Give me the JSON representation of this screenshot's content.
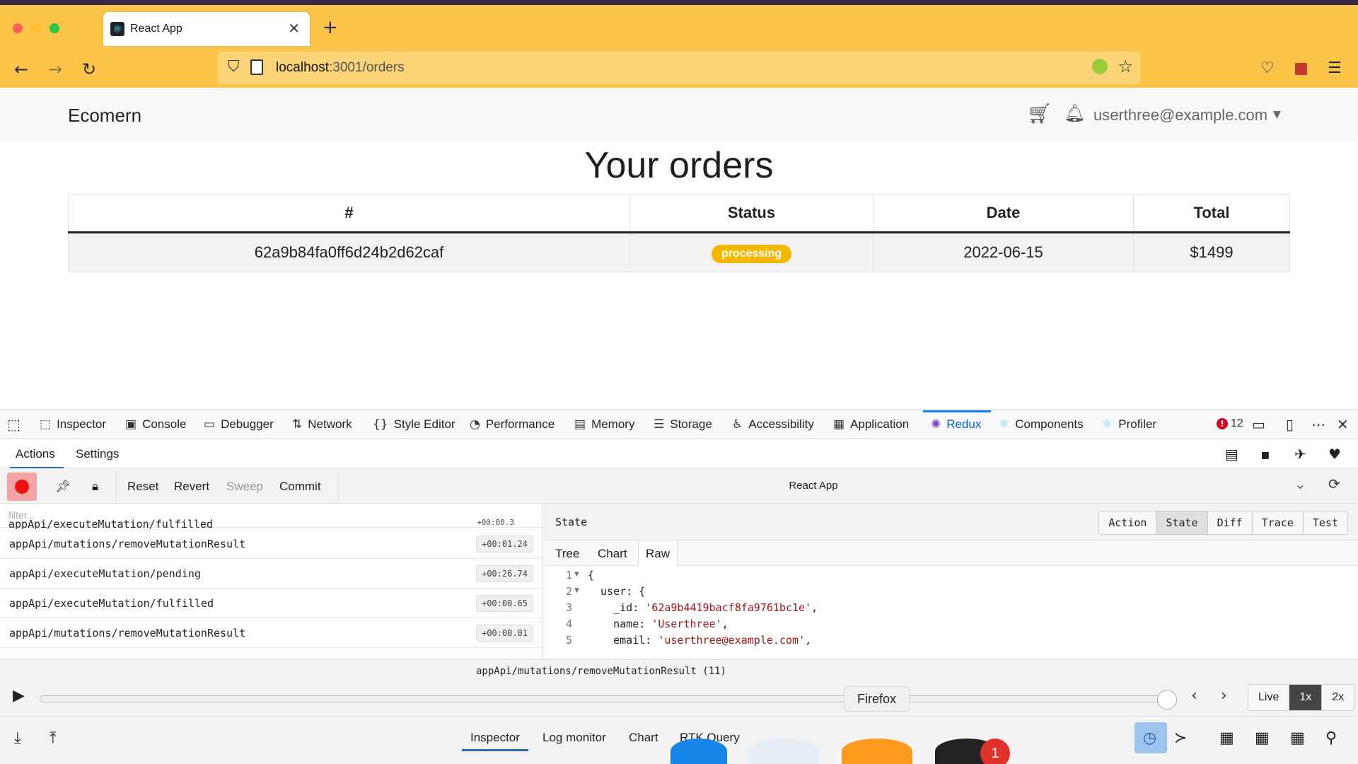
{
  "browser": {
    "tab_title": "React App",
    "tab_close": "✕",
    "new_tab": "+",
    "url_host": "localhost",
    "url_rest": ":3001/orders"
  },
  "app": {
    "brand": "Ecomern",
    "user_email": "userthree@example.com",
    "page_title": "Your orders",
    "table": {
      "headers": [
        "#",
        "Status",
        "Date",
        "Total"
      ],
      "rows": [
        {
          "id": "62a9b84fa0ff6d24b2d62caf",
          "status": "processing",
          "date": "2022-06-15",
          "total": "$1499"
        }
      ]
    },
    "status_color": "#f5b700"
  },
  "devtools": {
    "tabs": [
      "Inspector",
      "Console",
      "Debugger",
      "Network",
      "Style Editor",
      "Performance",
      "Memory",
      "Storage",
      "Accessibility",
      "Application",
      "Redux",
      "Components",
      "Profiler"
    ],
    "active_tab": "Redux",
    "error_count": "12",
    "redux": {
      "subtabs": [
        "Actions",
        "Settings"
      ],
      "buttons": {
        "reset": "Reset",
        "revert": "Revert",
        "sweep": "Sweep",
        "commit": "Commit"
      },
      "instance": "React App",
      "filter_placeholder": "filter...",
      "actions": [
        {
          "name": "appApi/mutations/removeMutationResult",
          "time": "+00:01.24"
        },
        {
          "name": "appApi/executeMutation/pending",
          "time": "+00:26.74"
        },
        {
          "name": "appApi/executeMutation/fulfilled",
          "time": "+00:00.65"
        },
        {
          "name": "appApi/mutations/removeMutationResult",
          "time": "+00:00.01"
        }
      ],
      "cut_action": "appApi/executeMutation/fulfilled",
      "cut_time": "+00:00.3",
      "state_label": "State",
      "monitor_tabs": [
        "Action",
        "State",
        "Diff",
        "Trace",
        "Test"
      ],
      "view_tabs": [
        "Tree",
        "Chart",
        "Raw"
      ],
      "code_lines": [
        {
          "n": "1",
          "text": "{"
        },
        {
          "n": "2",
          "text": "  user: {"
        },
        {
          "n": "3",
          "key": "    _id: ",
          "str": "'62a9b4419bacf8fa9761bc1e'",
          "end": ","
        },
        {
          "n": "4",
          "key": "    name: ",
          "str": "'Userthree'",
          "end": ","
        },
        {
          "n": "5",
          "key": "    email: ",
          "str": "'userthree@example.com'",
          "end": ","
        }
      ],
      "current_action": "appApi/mutations/removeMutationResult (11)",
      "speeds": [
        "Live",
        "1x",
        "2x"
      ],
      "bottom_tabs": [
        "Inspector",
        "Log monitor",
        "Chart",
        "RTK Query"
      ]
    }
  },
  "dock": {
    "tooltip": "Firefox",
    "badge": "1"
  }
}
